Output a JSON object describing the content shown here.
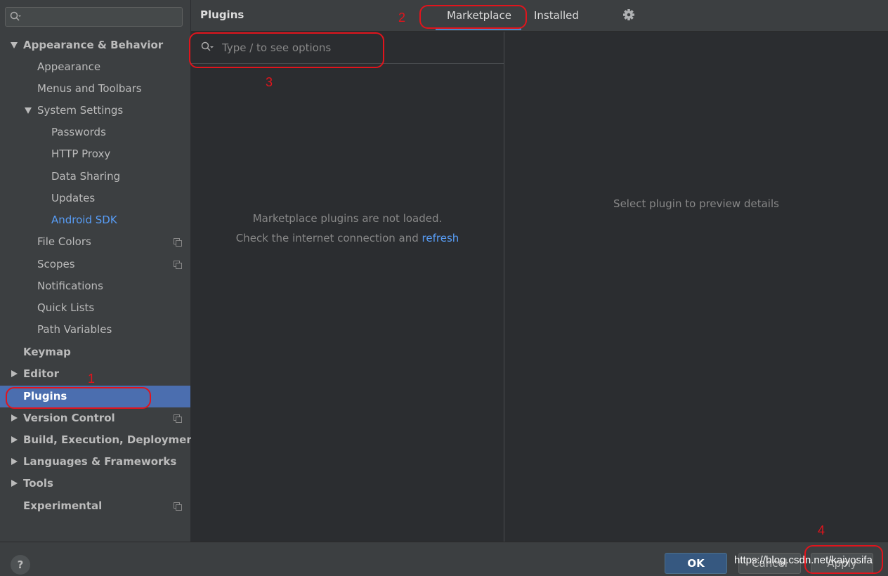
{
  "sidebar": {
    "search": {
      "value": "",
      "placeholder": "",
      "icon": "search-icon"
    },
    "items": [
      {
        "label": "Appearance & Behavior"
      },
      {
        "label": "Appearance"
      },
      {
        "label": "Menus and Toolbars"
      },
      {
        "label": "System Settings"
      },
      {
        "label": "Passwords"
      },
      {
        "label": "HTTP Proxy"
      },
      {
        "label": "Data Sharing"
      },
      {
        "label": "Updates"
      },
      {
        "label": "Android SDK"
      },
      {
        "label": "File Colors"
      },
      {
        "label": "Scopes"
      },
      {
        "label": "Notifications"
      },
      {
        "label": "Quick Lists"
      },
      {
        "label": "Path Variables"
      },
      {
        "label": "Keymap"
      },
      {
        "label": "Editor"
      },
      {
        "label": "Plugins"
      },
      {
        "label": "Version Control"
      },
      {
        "label": "Build, Execution, Deployment"
      },
      {
        "label": "Languages & Frameworks"
      },
      {
        "label": "Tools"
      },
      {
        "label": "Experimental"
      }
    ]
  },
  "header": {
    "title": "Plugins",
    "tabs": [
      {
        "label": "Marketplace",
        "selected": true
      },
      {
        "label": "Installed",
        "selected": false
      }
    ],
    "settings_icon": "gear-icon"
  },
  "plugin_list": {
    "search": {
      "value": "",
      "placeholder": "Type / to see options"
    },
    "empty_line1": "Marketplace plugins are not loaded.",
    "empty_line2": "Check the internet connection and",
    "refresh_link": "refresh"
  },
  "details": {
    "empty_message": "Select plugin to preview details"
  },
  "footer": {
    "help_label": "?",
    "ok_label": "OK",
    "cancel_label": "Cancel",
    "apply_label": "Apply"
  },
  "watermark": "https://blog.csdn.net/kaiyosifa",
  "annotations": {
    "num1": "1",
    "num2": "2",
    "num3": "3",
    "num4": "4",
    "color": "#e1141c"
  },
  "colors": {
    "accent_selection": "#4b6eaf",
    "link": "#589df6",
    "sidebar_bg": "#3c3f41",
    "content_bg": "#2b2d30"
  }
}
